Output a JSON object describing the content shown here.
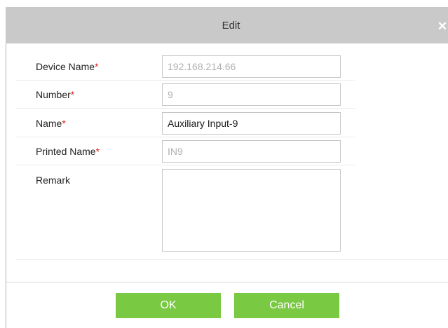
{
  "dialog": {
    "title": "Edit",
    "close_glyph": "✕",
    "close_icon": "close-icon"
  },
  "form": {
    "fields": [
      {
        "label": "Device Name",
        "required": "*",
        "value": "192.168.214.66",
        "editable": false
      },
      {
        "label": "Number",
        "required": "*",
        "value": "9",
        "editable": false
      },
      {
        "label": "Name",
        "required": "*",
        "value": "Auxiliary Input-9",
        "editable": true
      },
      {
        "label": "Printed Name",
        "required": "*",
        "value": "IN9",
        "editable": false
      }
    ],
    "remark": {
      "label": "Remark",
      "value": ""
    }
  },
  "buttons": {
    "ok_label": "OK",
    "cancel_label": "Cancel"
  },
  "colors": {
    "button_green": "#7ac943",
    "required_red": "#e0201c",
    "titlebar_gray": "#c9c9c9"
  }
}
